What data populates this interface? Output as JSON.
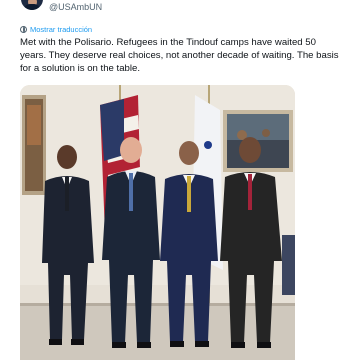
{
  "tweet": {
    "handle": "@USAmbUN",
    "translate_label": "Mostrar traducción",
    "text": "Met with the Polisario. Refugees in the Tindouf camps have waited 50 years. They deserve real choices, not another decade of waiting. The basis for a solution is on the table."
  },
  "icons": [
    "profile-avatar",
    "globe-icon"
  ],
  "colors": {
    "link": "#1d9bf0",
    "secondary_text": "#536471",
    "text": "#0f1419"
  }
}
